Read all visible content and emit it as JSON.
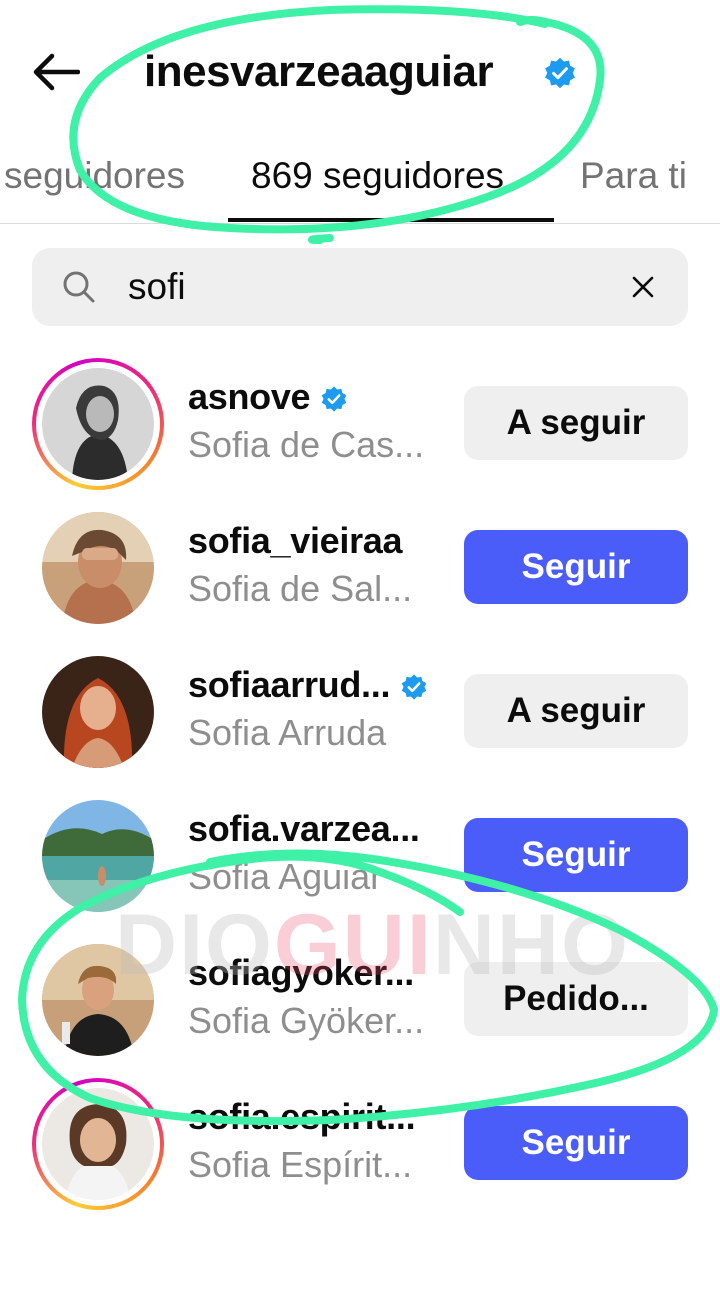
{
  "header": {
    "back_icon": "arrow-left-icon",
    "title": "inesvarzeaaguiar",
    "verified": true
  },
  "tabs": [
    {
      "label": "seguidores",
      "active": false
    },
    {
      "label": "869 seguidores",
      "active": true
    },
    {
      "label": "Para ti",
      "active": false
    }
  ],
  "search": {
    "icon": "search-icon",
    "value": "sofi",
    "clear_icon": "close-icon"
  },
  "users": [
    {
      "username": "asnove",
      "verified": true,
      "full_name": "Sofia de Cas...",
      "button": "A seguir",
      "button_style": "following",
      "story_ring": true
    },
    {
      "username": "sofia_vieiraa",
      "verified": false,
      "full_name": "Sofia de Sal...",
      "button": "Seguir",
      "button_style": "follow",
      "story_ring": false
    },
    {
      "username": "sofiaarrud...",
      "verified": true,
      "full_name": "Sofia Arruda",
      "button": "A seguir",
      "button_style": "following",
      "story_ring": false
    },
    {
      "username": "sofia.varzea...",
      "verified": false,
      "full_name": "Sofia Aguiar",
      "button": "Seguir",
      "button_style": "follow",
      "story_ring": false
    },
    {
      "username": "sofiagyoker...",
      "verified": false,
      "full_name": "Sofia Gyöker...",
      "button": "Pedido...",
      "button_style": "following",
      "story_ring": false
    },
    {
      "username": "sofia.espirit...",
      "verified": false,
      "full_name": "Sofia Espírit...",
      "button": "Seguir",
      "button_style": "follow",
      "story_ring": true
    }
  ],
  "watermark": {
    "part1": "DIO",
    "part2": "GUI",
    "part3": "NHO"
  },
  "colors": {
    "follow_button": "#4a5df9",
    "following_button": "#efefef",
    "verified_badge": "#1d9bf0",
    "annotation_marker": "#3ef1a6"
  }
}
